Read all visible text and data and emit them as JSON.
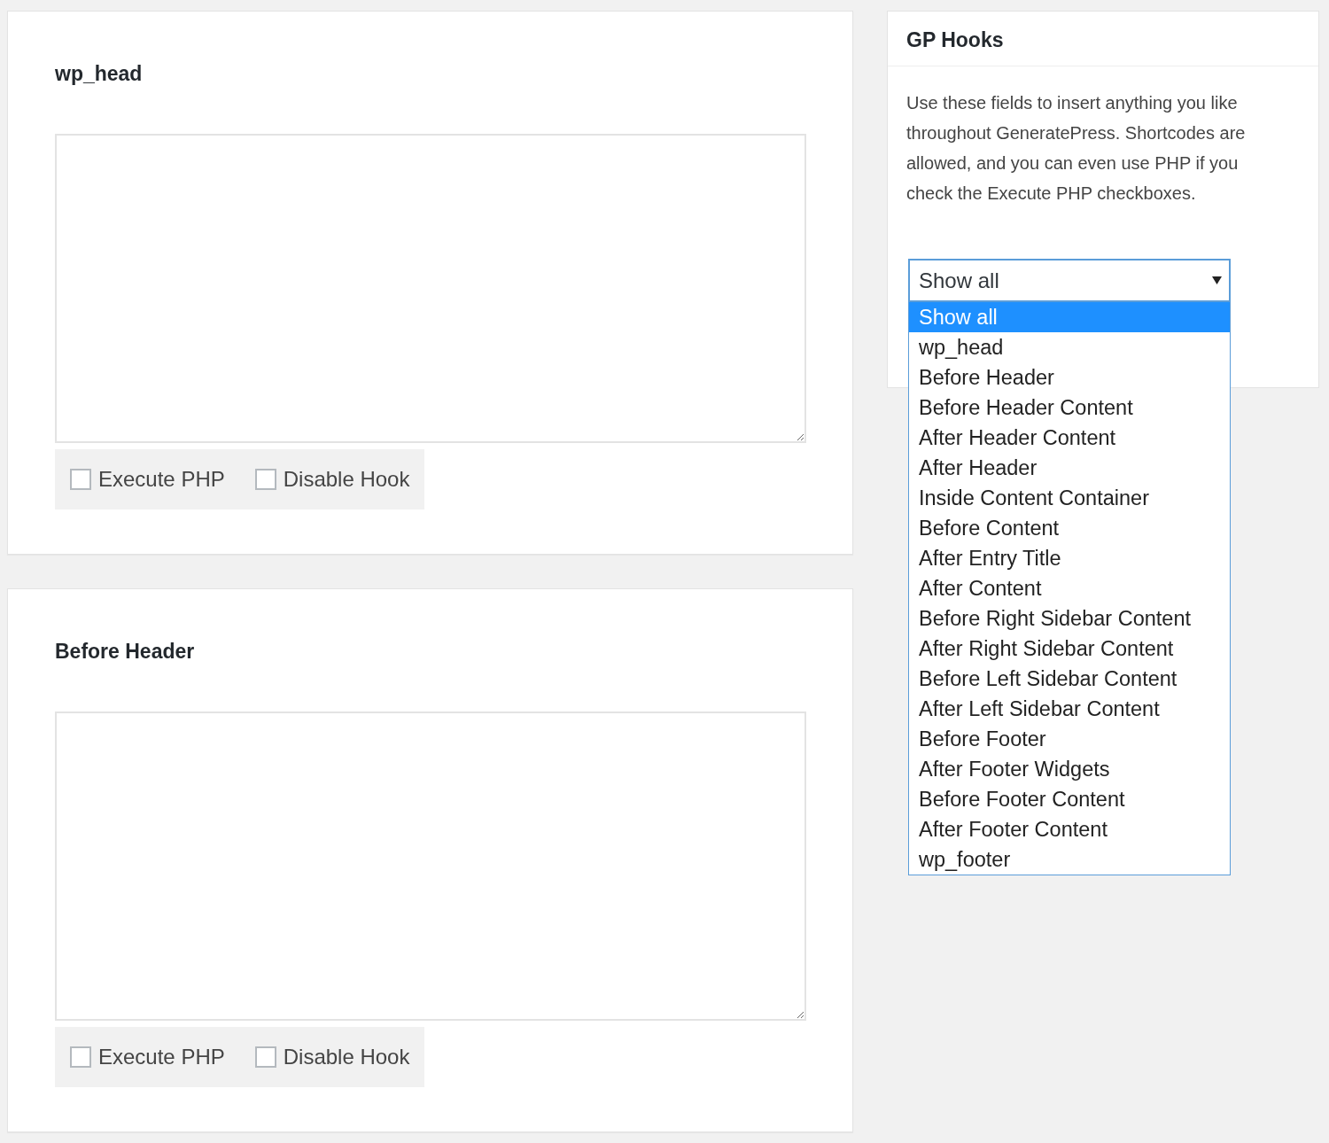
{
  "hook_panels": [
    {
      "title": "wp_head",
      "checkboxes": [
        {
          "label": "Execute PHP",
          "checked": false
        },
        {
          "label": "Disable Hook",
          "checked": false
        }
      ]
    },
    {
      "title": "Before Header",
      "checkboxes": [
        {
          "label": "Execute PHP",
          "checked": false
        },
        {
          "label": "Disable Hook",
          "checked": false
        }
      ]
    }
  ],
  "sidebar": {
    "title": "GP Hooks",
    "description": "Use these fields to insert anything you like throughout GeneratePress. Shortcodes are allowed, and you can even use PHP if you check the Execute PHP checkboxes.",
    "filter": {
      "value": "Show all",
      "expanded": true,
      "options": [
        {
          "label": "Show all",
          "selected": true
        },
        {
          "label": "wp_head",
          "selected": false
        },
        {
          "label": "Before Header",
          "selected": false
        },
        {
          "label": "Before Header Content",
          "selected": false
        },
        {
          "label": "After Header Content",
          "selected": false
        },
        {
          "label": "After Header",
          "selected": false
        },
        {
          "label": "Inside Content Container",
          "selected": false
        },
        {
          "label": "Before Content",
          "selected": false
        },
        {
          "label": "After Entry Title",
          "selected": false
        },
        {
          "label": "After Content",
          "selected": false
        },
        {
          "label": "Before Right Sidebar Content",
          "selected": false
        },
        {
          "label": "After Right Sidebar Content",
          "selected": false
        },
        {
          "label": "Before Left Sidebar Content",
          "selected": false
        },
        {
          "label": "After Left Sidebar Content",
          "selected": false
        },
        {
          "label": "Before Footer",
          "selected": false
        },
        {
          "label": "After Footer Widgets",
          "selected": false
        },
        {
          "label": "Before Footer Content",
          "selected": false
        },
        {
          "label": "After Footer Content",
          "selected": false
        },
        {
          "label": "wp_footer",
          "selected": false
        }
      ]
    }
  }
}
